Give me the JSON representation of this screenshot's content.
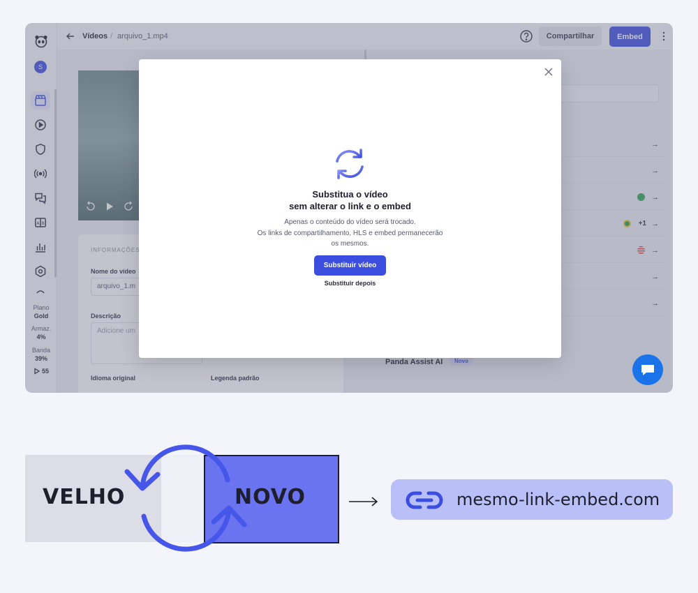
{
  "topbar": {
    "breadcrumb_root": "Vídeos",
    "breadcrumb_sep": "/",
    "breadcrumb_file": "arquivo_1.mp4",
    "share_label": "Compartilhar",
    "embed_label": "Embed"
  },
  "sidebar": {
    "avatar_initial": "S",
    "plan_label": "Plano",
    "plan_value": "Gold",
    "storage_label": "Armaz.",
    "storage_value": "4%",
    "bandwidth_label": "Banda",
    "bandwidth_value": "39%",
    "credits_value": "55"
  },
  "form": {
    "section_title": "INFORMAÇÕES P",
    "name_label": "Nome do vídeo",
    "name_value": "arquivo_1.m",
    "desc_label": "Descrição",
    "desc_placeholder": "Adicione um",
    "lang_label": "Idioma original",
    "subtitle_label": "Legenda padrão"
  },
  "right_panel": {
    "rows": [
      {
        "arrow": "→"
      },
      {
        "arrow": "→"
      },
      {
        "arrow": "→"
      },
      {
        "arrow": "→",
        "extra": "+1"
      },
      {
        "arrow": "→"
      },
      {
        "arrow": "→"
      },
      {
        "arrow": "→"
      }
    ],
    "assist_label": "Panda Assist AI",
    "new_badge": "Novo"
  },
  "modal": {
    "title_line1": "Substitua o vídeo",
    "title_line2": "sem alterar o link e o embed",
    "desc_line1": "Apenas o conteúdo do vídeo será trocado.",
    "desc_line2": "Os links de compartilhamento, HLS e embed permanecerão",
    "desc_line3": "os mesmos.",
    "primary_label": "Substituir vídeo",
    "secondary_label": "Substituir depois"
  },
  "illustration": {
    "old_label": "VELHO",
    "new_label": "NOVO",
    "link_text": "mesmo-link-embed.com"
  },
  "colors": {
    "accent": "#3b4ee0",
    "new_box": "#6b74f0",
    "link_pill": "#b9c0f7",
    "chat": "#1a73e8"
  }
}
